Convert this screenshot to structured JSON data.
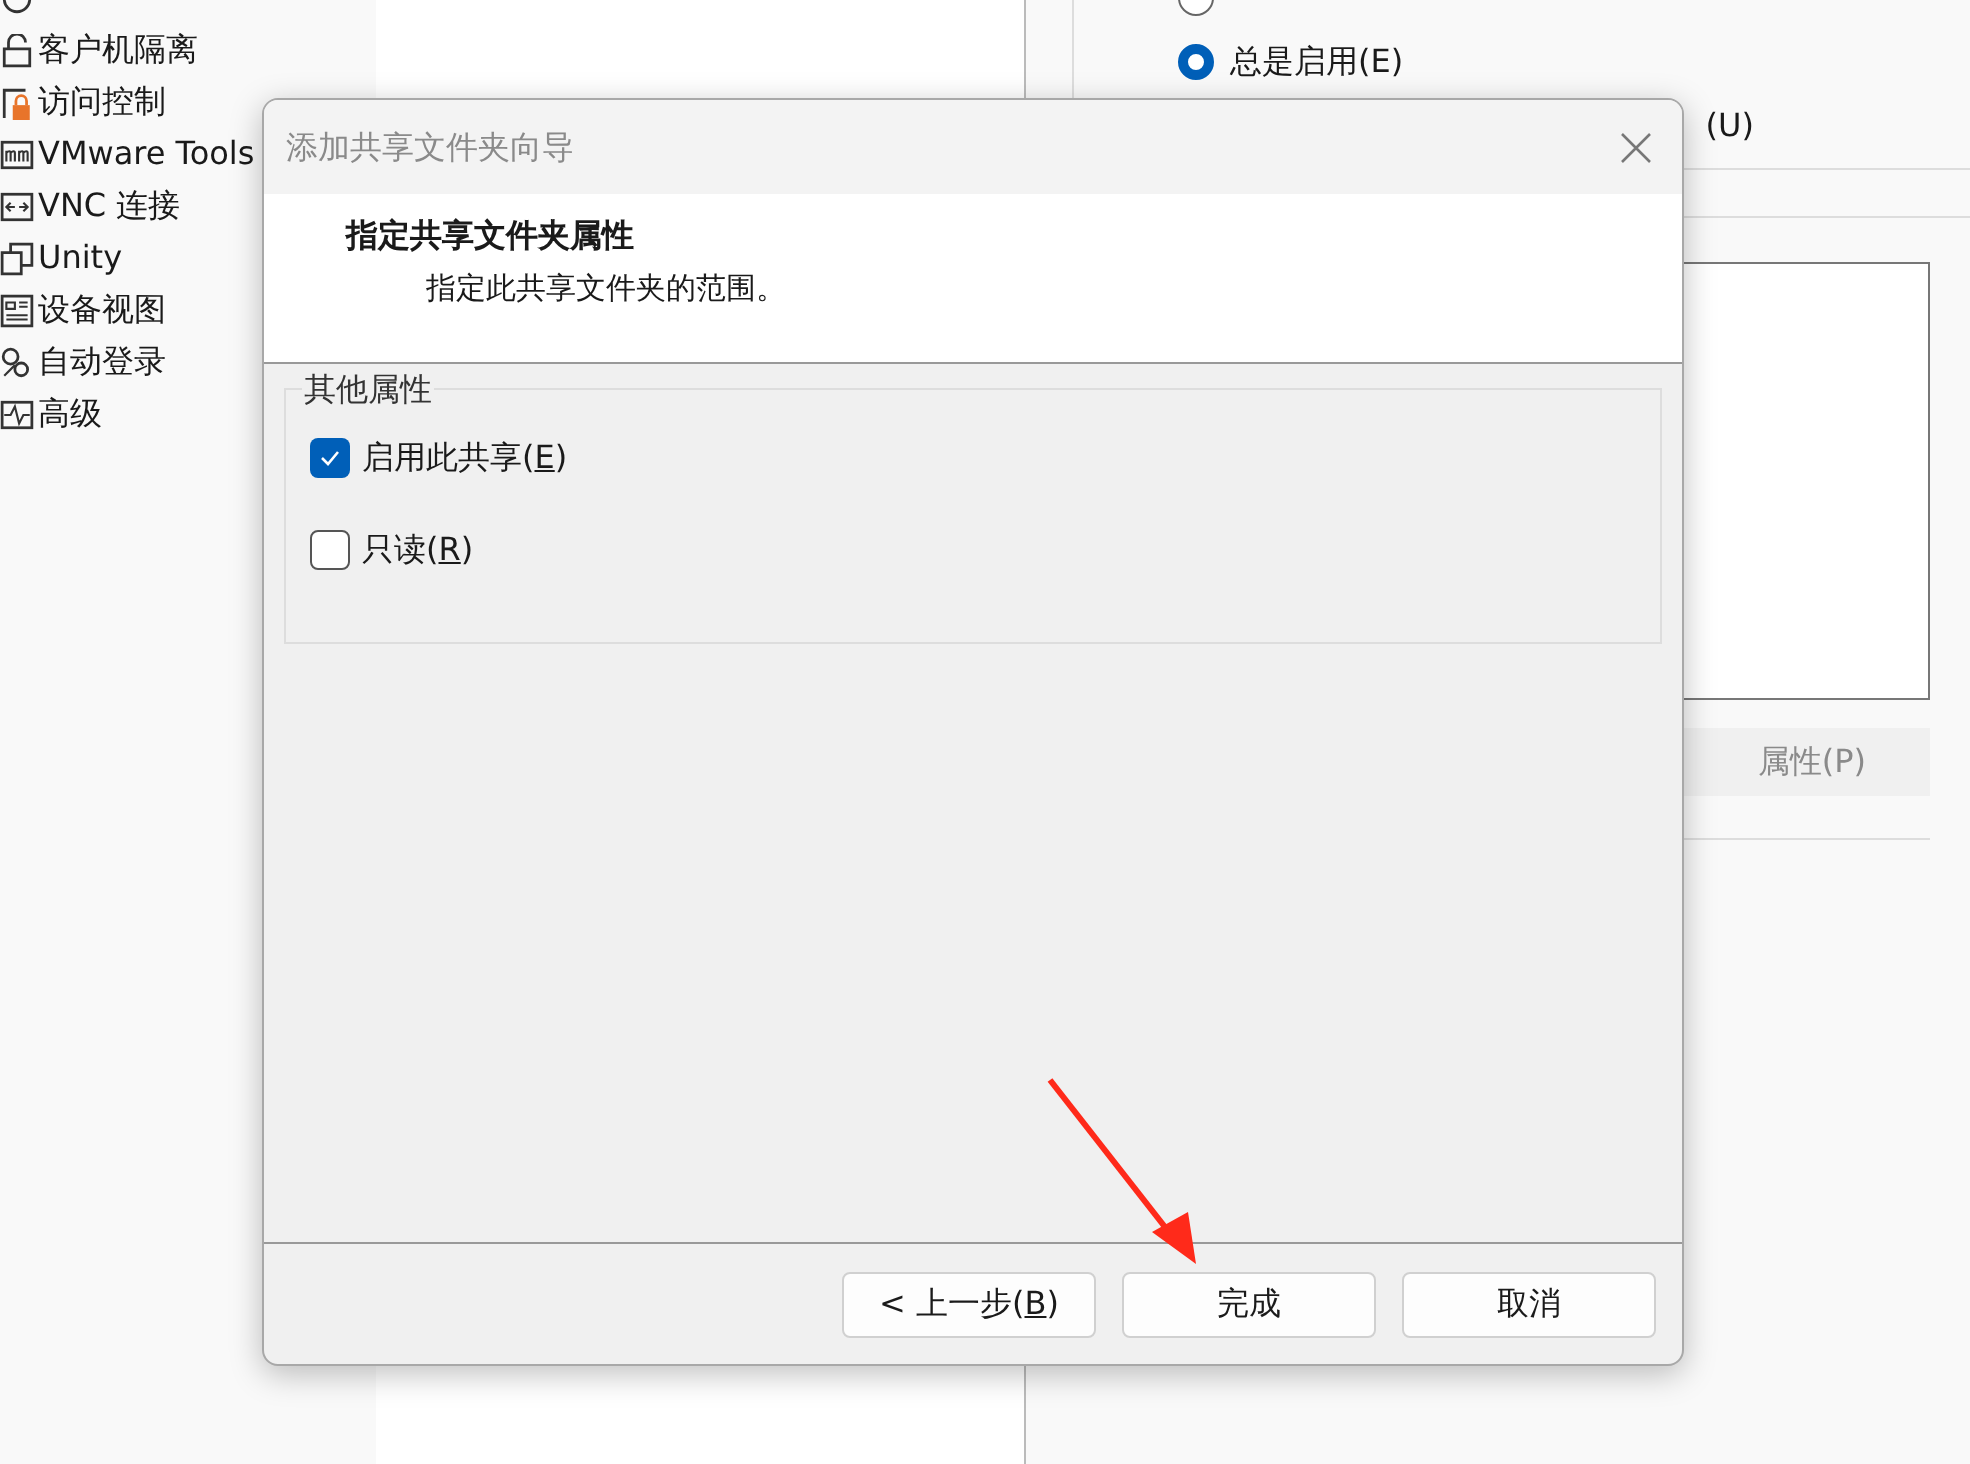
{
  "tree": [
    {
      "label": "客户机隔离"
    },
    {
      "label": "访问控制"
    },
    {
      "label": "VMware Tools"
    },
    {
      "label": "VNC 连接"
    },
    {
      "label": "Unity"
    },
    {
      "label": "设备视图"
    },
    {
      "label": "自动登录"
    },
    {
      "label": "高级"
    }
  ],
  "right_panel": {
    "radios": [
      {
        "selected": false
      },
      {
        "label": "总是启用(E)",
        "selected": true
      }
    ],
    "partial_option": "(U)",
    "properties_button": {
      "label": "属性(P)",
      "disabled": true
    }
  },
  "dialog": {
    "title": "添加共享文件夹向导",
    "header": {
      "title": "指定共享文件夹属性",
      "subtitle": "指定此共享文件夹的范围。"
    },
    "group": {
      "legend": "其他属性",
      "options": [
        {
          "before": "启用此共享(",
          "key": "E",
          "after": ")",
          "checked": true
        },
        {
          "before": "只读(",
          "key": "R",
          "after": ")",
          "checked": false
        }
      ]
    },
    "buttons": [
      {
        "before": "< 上一步(",
        "key": "B",
        "after": ")"
      },
      {
        "before": "完成"
      },
      {
        "before": "取消"
      }
    ]
  }
}
